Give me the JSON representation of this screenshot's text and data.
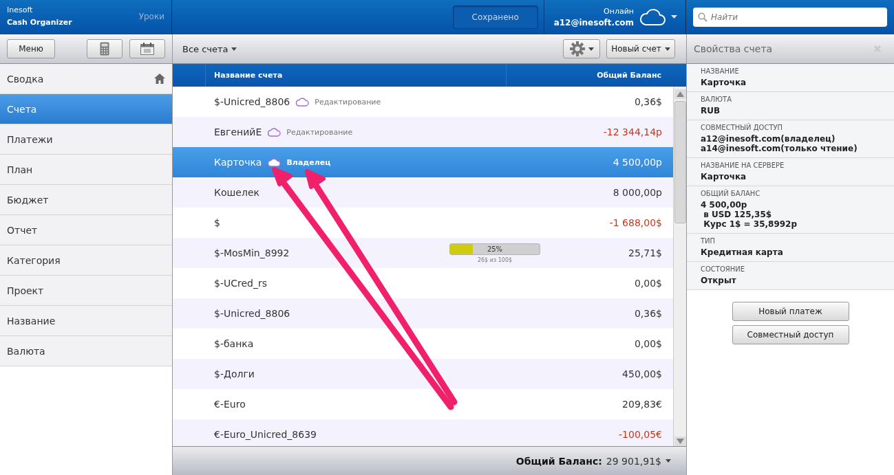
{
  "app": {
    "vendor": "Inesoft",
    "product": "Cash Organizer",
    "lessons_link": "Уроки"
  },
  "header": {
    "save_status": "Сохранено",
    "online_label": "Онлайн",
    "account": "a12@inesoft.com",
    "search": {
      "placeholder": "Найти"
    }
  },
  "toolbar": {
    "menu_button": "Меню",
    "filter": "Все счета",
    "new_account_button": "Новый счет"
  },
  "sidebar": {
    "items": [
      {
        "label": "Сводка",
        "kind": "home",
        "selected": false
      },
      {
        "label": "Счета",
        "kind": "plain",
        "selected": true
      },
      {
        "label": "Платежи",
        "kind": "plain",
        "selected": false
      },
      {
        "label": "План",
        "kind": "plain",
        "selected": false
      },
      {
        "label": "Бюджет",
        "kind": "plain",
        "selected": false
      },
      {
        "label": "Отчет",
        "kind": "plain",
        "selected": false
      },
      {
        "label": "Категория",
        "kind": "plain",
        "selected": false
      },
      {
        "label": "Проект",
        "kind": "plain",
        "selected": false
      },
      {
        "label": "Название",
        "kind": "plain",
        "selected": false
      },
      {
        "label": "Валюта",
        "kind": "plain",
        "selected": false
      }
    ]
  },
  "table": {
    "columns": [
      "Название счета",
      "Общий Баланс"
    ],
    "rows": [
      {
        "name": "$-Unicred_8806",
        "shared": true,
        "access": "Редактирование",
        "balance": "0,36$",
        "negative": false,
        "selected": false
      },
      {
        "name": "ЕвгенийЕ",
        "shared": true,
        "access": "Редактирование",
        "balance": "-12 344,14р",
        "negative": true,
        "selected": false
      },
      {
        "name": "Карточка",
        "shared": true,
        "access": "Владелец",
        "balance": "4 500,00р",
        "negative": false,
        "selected": true
      },
      {
        "name": "Кошелек",
        "shared": false,
        "balance": "8 000,00р",
        "negative": false,
        "selected": false
      },
      {
        "name": "$",
        "shared": false,
        "balance": "-1 688,00$",
        "negative": true,
        "selected": false
      },
      {
        "name": "$-MosMin_8992",
        "shared": false,
        "balance": "25,71$",
        "negative": false,
        "selected": false,
        "progress": {
          "level": 0.25,
          "label": "25%",
          "caption": "26$ из 100$"
        }
      },
      {
        "name": "$-UCred_rs",
        "shared": false,
        "balance": "0,00$",
        "negative": false,
        "selected": false
      },
      {
        "name": "$-Unicred_8806",
        "shared": false,
        "balance": "0,36$",
        "negative": false,
        "selected": false
      },
      {
        "name": "$-банка",
        "shared": false,
        "balance": "0,00$",
        "negative": false,
        "selected": false
      },
      {
        "name": "$-Долги",
        "shared": false,
        "balance": "450,00$",
        "negative": false,
        "selected": false
      },
      {
        "name": "€-Euro",
        "shared": false,
        "balance": "209,83€",
        "negative": false,
        "selected": false
      },
      {
        "name": "€-Euro_Unicred_8639",
        "shared": false,
        "balance": "-100,05€",
        "negative": true,
        "selected": false
      }
    ],
    "footer": {
      "label": "Общий Баланс:",
      "value": "29 901,91$"
    }
  },
  "properties": {
    "title": "Свойства счета",
    "fields": [
      {
        "label": "НАЗВАНИЕ",
        "lines": [
          "Карточка"
        ]
      },
      {
        "label": "ВАЛЮТА",
        "lines": [
          "RUB"
        ]
      },
      {
        "label": "СОВМЕСТНЫЙ ДОСТУП",
        "lines": [
          "a12@inesoft.com(владелец)",
          "a14@inesoft.com(только чтение)"
        ]
      },
      {
        "label": "НАЗВАНИЕ НА СЕРВЕРЕ",
        "lines": [
          "Карточка"
        ]
      },
      {
        "label": "ОБЩИЙ БАЛАНС",
        "lines": [
          "4 500,00р",
          " в USD 125,35$",
          " Курс 1$ = 35,8992р"
        ]
      },
      {
        "label": "ТИП",
        "lines": [
          "Кредитная карта"
        ]
      },
      {
        "label": "СОСТОЯНИЕ",
        "lines": [
          "Открыт"
        ]
      }
    ],
    "buttons": [
      "Новый платеж",
      "Совместный доступ"
    ]
  }
}
